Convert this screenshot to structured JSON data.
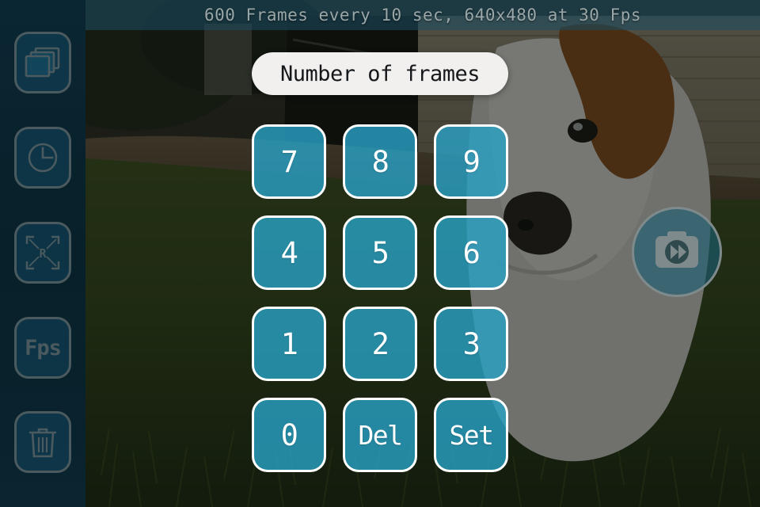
{
  "statusbar": {
    "text": "600 Frames  every 10 sec, 640x480 at 30 Fps",
    "frames": "600",
    "interval": "10 sec",
    "resolution": "640x480",
    "fps": "30 Fps"
  },
  "dialog": {
    "title": "Number of frames",
    "keys": [
      {
        "label": "7",
        "name": "key-7"
      },
      {
        "label": "8",
        "name": "key-8"
      },
      {
        "label": "9",
        "name": "key-9"
      },
      {
        "label": "4",
        "name": "key-4"
      },
      {
        "label": "5",
        "name": "key-5"
      },
      {
        "label": "6",
        "name": "key-6"
      },
      {
        "label": "1",
        "name": "key-1"
      },
      {
        "label": "2",
        "name": "key-2"
      },
      {
        "label": "3",
        "name": "key-3"
      },
      {
        "label": "0",
        "name": "key-0"
      },
      {
        "label": "Del",
        "name": "key-delete"
      },
      {
        "label": "Set",
        "name": "key-set"
      }
    ]
  },
  "sidebar": {
    "items": [
      {
        "icon": "frames-stack-icon",
        "label": ""
      },
      {
        "icon": "clock-icon",
        "label": ""
      },
      {
        "icon": "resolution-icon",
        "label": ""
      },
      {
        "icon": "fps-icon",
        "label": "Fps"
      },
      {
        "icon": "trash-icon",
        "label": ""
      }
    ]
  },
  "record": {
    "icon": "timelapse-camera-icon"
  },
  "colors": {
    "sidebar_bg": "#0a2430",
    "icon_stroke": "#4a5a5e",
    "key_fill": "#29a2c7",
    "key_border": "#ffffff",
    "title_pill_bg": "#f2f0ee",
    "title_text": "#15171a",
    "statusbar_text": "#9aa7a9"
  }
}
